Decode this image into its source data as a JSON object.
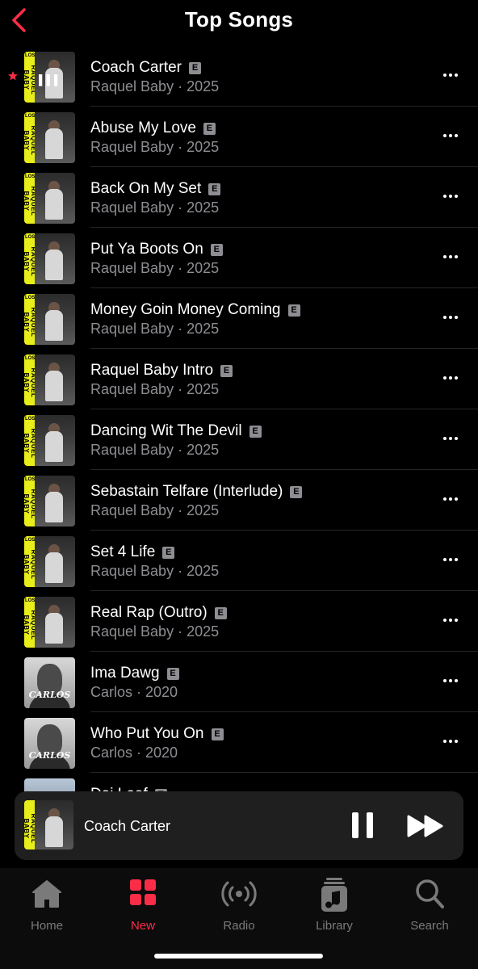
{
  "header": {
    "title": "Top Songs"
  },
  "songs": [
    {
      "title": "Coach Carter",
      "explicit": "E",
      "subtitle": "Raquel Baby · 2025",
      "cover": "raquel",
      "playing": true,
      "starred": true
    },
    {
      "title": "Abuse My Love",
      "explicit": "E",
      "subtitle": "Raquel Baby · 2025",
      "cover": "raquel"
    },
    {
      "title": "Back On My Set",
      "explicit": "E",
      "subtitle": "Raquel Baby · 2025",
      "cover": "raquel"
    },
    {
      "title": "Put Ya Boots On",
      "explicit": "E",
      "subtitle": "Raquel Baby · 2025",
      "cover": "raquel"
    },
    {
      "title": "Money Goin Money Coming",
      "explicit": "E",
      "subtitle": "Raquel Baby · 2025",
      "cover": "raquel"
    },
    {
      "title": "Raquel Baby Intro",
      "explicit": "E",
      "subtitle": "Raquel Baby · 2025",
      "cover": "raquel"
    },
    {
      "title": "Dancing Wit The Devil",
      "explicit": "E",
      "subtitle": "Raquel Baby · 2025",
      "cover": "raquel"
    },
    {
      "title": "Sebastain Telfare (Interlude)",
      "explicit": "E",
      "subtitle": "Raquel Baby · 2025",
      "cover": "raquel"
    },
    {
      "title": "Set 4 Life",
      "explicit": "E",
      "subtitle": "Raquel Baby · 2025",
      "cover": "raquel"
    },
    {
      "title": "Real Rap (Outro)",
      "explicit": "E",
      "subtitle": "Raquel Baby · 2025",
      "cover": "raquel"
    },
    {
      "title": "Ima Dawg",
      "explicit": "E",
      "subtitle": "Carlos · 2020",
      "cover": "carlos"
    },
    {
      "title": "Who Put You On",
      "explicit": "E",
      "subtitle": "Carlos · 2020",
      "cover": "carlos"
    },
    {
      "title": "Dai Loaf",
      "explicit": "E",
      "subtitle": "",
      "cover": "partial"
    }
  ],
  "cover_text": {
    "raquel_band": "RAQUEL BABY",
    "raquel_los": "LOS",
    "carlos_name": "CARLOS"
  },
  "mini_player": {
    "title": "Coach Carter"
  },
  "tabs": [
    {
      "label": "Home",
      "icon": "home-icon"
    },
    {
      "label": "New",
      "icon": "new-grid-icon",
      "active": true
    },
    {
      "label": "Radio",
      "icon": "radio-icon"
    },
    {
      "label": "Library",
      "icon": "library-icon"
    },
    {
      "label": "Search",
      "icon": "search-icon"
    }
  ],
  "colors": {
    "accent": "#fa2d48",
    "background": "#000000",
    "secondary_text": "#8e8e93",
    "tab_inactive": "#7a7a7a"
  }
}
